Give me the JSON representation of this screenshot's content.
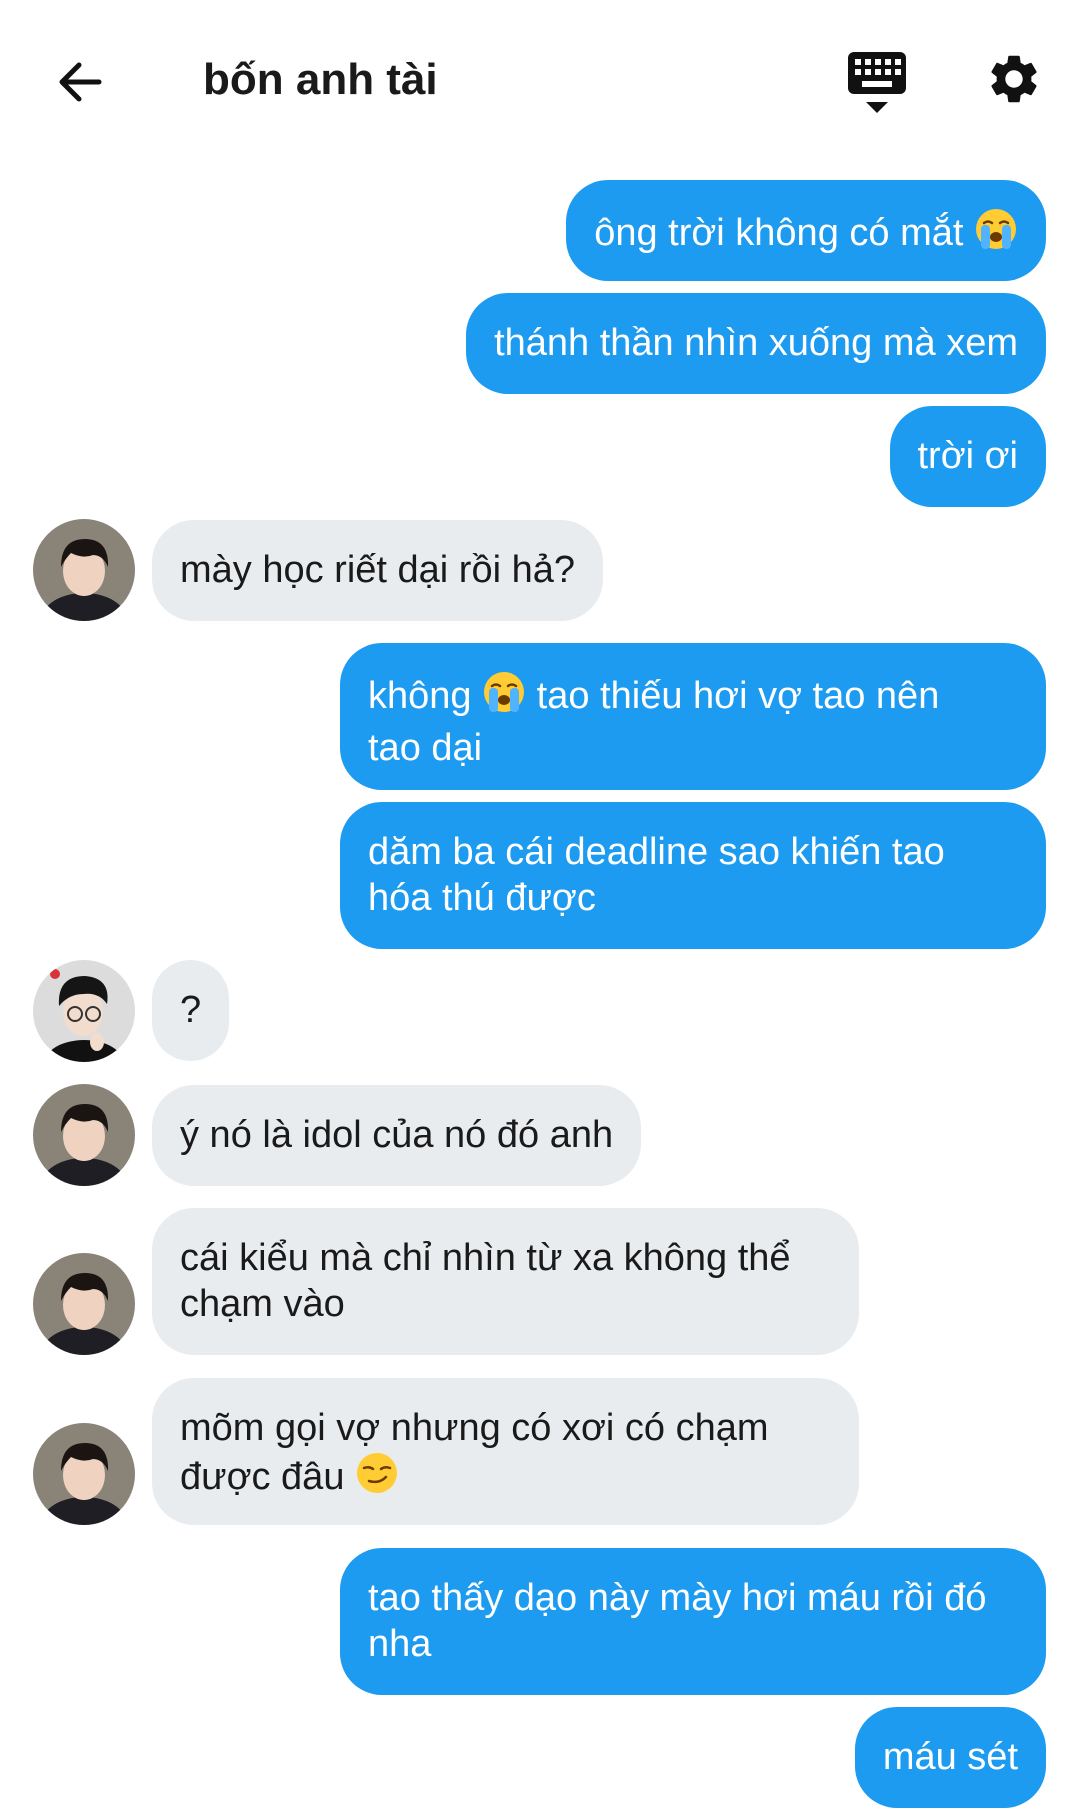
{
  "header": {
    "title": "bốn anh tài",
    "back_icon": "arrow-left-icon",
    "keyboard_icon": "keyboard-icon",
    "settings_icon": "gear-icon"
  },
  "colors": {
    "outgoing_bubble": "#1d9bf0",
    "incoming_bubble": "#e9ecef",
    "text_dark": "#1a1a1a"
  },
  "messages": [
    {
      "direction": "out",
      "text_before": "ông trời không có mắt",
      "emoji": "loudly-crying-face"
    },
    {
      "direction": "out",
      "text": "thánh thần nhìn xuống mà xem"
    },
    {
      "direction": "out",
      "text": "trời ơi"
    },
    {
      "direction": "in",
      "text": "mày học riết dại rồi hả?"
    },
    {
      "direction": "out",
      "text_before": "không",
      "emoji": "loudly-crying-face",
      "text_after": "tao thiếu hơi vợ tao nên",
      "text_line2": "tao dại"
    },
    {
      "direction": "out",
      "text": "dăm ba cái deadline sao khiến tao",
      "text_line2": "hóa thú được"
    },
    {
      "direction": "in",
      "text": "?"
    },
    {
      "direction": "in",
      "text": "ý nó là idol của nó đó anh"
    },
    {
      "direction": "in",
      "text": "cái kiểu mà chỉ nhìn từ xa không thể",
      "text_line2": "chạm vào"
    },
    {
      "direction": "in",
      "text": "mõm gọi vợ nhưng có xơi có chạm",
      "text_line2_before": "được đâu",
      "emoji": "smirking-face"
    },
    {
      "direction": "out",
      "text": "tao thấy dạo này mày hơi máu rồi đó",
      "text_line2": "nha"
    },
    {
      "direction": "out",
      "text": "máu sét"
    }
  ]
}
